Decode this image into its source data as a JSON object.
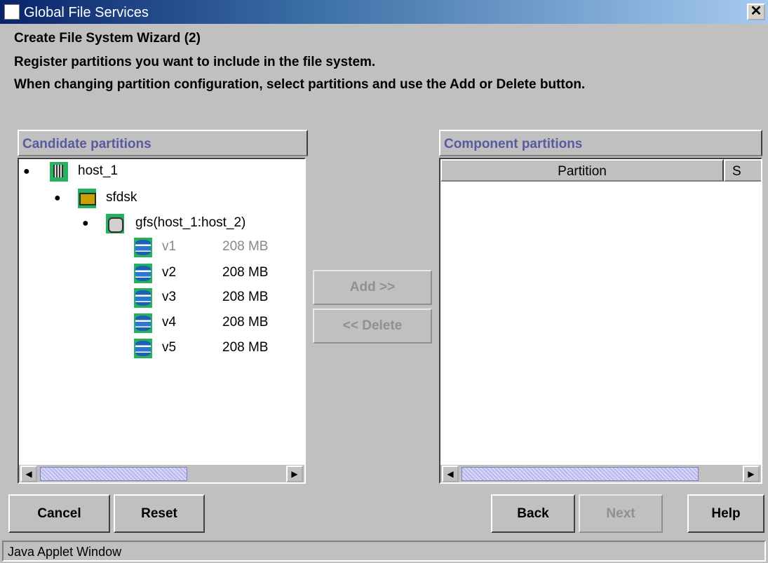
{
  "window": {
    "title": "Global File Services"
  },
  "wizard": {
    "heading": "Create File System Wizard (2)",
    "line1": "Register partitions you want to include in the file system.",
    "line2": "When changing partition configuration, select partitions and use the Add or Delete button."
  },
  "candidate": {
    "header": "Candidate partitions",
    "host": "host_1",
    "class": "sfdsk",
    "group": "gfs(host_1:host_2)",
    "volumes": [
      {
        "name": "v1",
        "size": "208 MB",
        "disabled": true
      },
      {
        "name": "v2",
        "size": "208 MB",
        "disabled": false
      },
      {
        "name": "v3",
        "size": "208 MB",
        "disabled": false
      },
      {
        "name": "v4",
        "size": "208 MB",
        "disabled": false
      },
      {
        "name": "v5",
        "size": "208 MB",
        "disabled": false
      }
    ]
  },
  "component": {
    "header": "Component partitions",
    "columns": [
      "Partition",
      "S"
    ]
  },
  "middle": {
    "add": "Add >>",
    "delete": "<< Delete"
  },
  "buttons": {
    "cancel": "Cancel",
    "reset": "Reset",
    "back": "Back",
    "next": "Next",
    "help": "Help"
  },
  "status": "Java Applet Window",
  "colors": {
    "titlebar": "#0a246a",
    "header_text": "#5a5aa0",
    "icon_bg": "#25b25f",
    "scroll_thumb": "#c8c8f0"
  }
}
